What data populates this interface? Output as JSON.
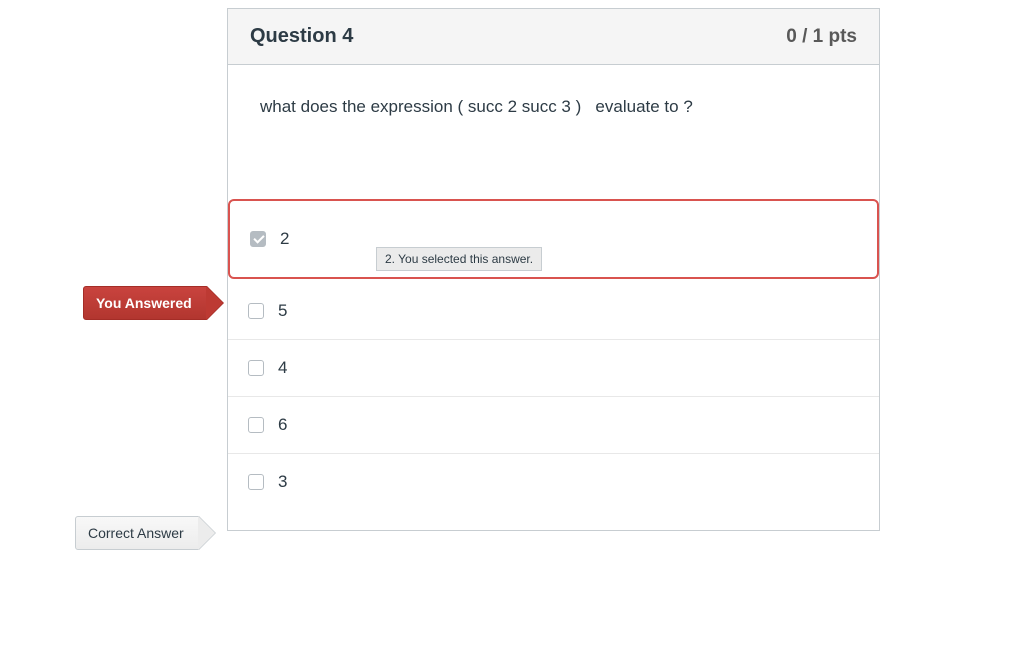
{
  "header": {
    "title": "Question 4",
    "points": "0 / 1 pts"
  },
  "question": {
    "text": "what does the expression ( succ 2 succ 3 )   evaluate to ?"
  },
  "answers": [
    {
      "label": "2",
      "checked": true,
      "selectedWrong": true
    },
    {
      "label": "5",
      "checked": false
    },
    {
      "label": "4",
      "checked": false
    },
    {
      "label": "6",
      "checked": false
    },
    {
      "label": "3",
      "checked": false
    }
  ],
  "tooltip": "2. You selected this answer.",
  "flags": {
    "youAnswered": "You Answered",
    "correctAnswer": "Correct Answer"
  }
}
